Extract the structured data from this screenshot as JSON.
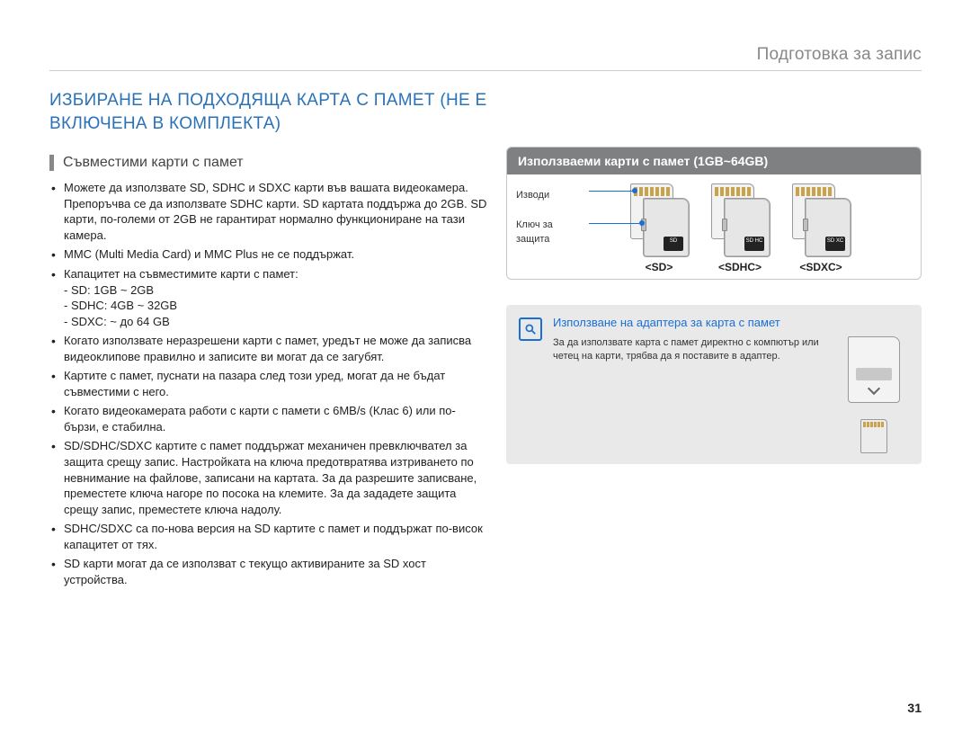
{
  "header": {
    "section": "Подготовка за запис"
  },
  "title": "ИЗБИРАНЕ НА ПОДХОДЯЩА КАРТА С ПАМЕТ (НЕ Е ВКЛЮЧЕНА В КОМПЛЕКТА)",
  "subheading": "Съвместими карти с памет",
  "bullets": [
    "Можете да използвате SD, SDHC и SDXC карти във вашата видеокамера. Препоръчва се да използвате SDHC карти. SD картата поддържа до 2GB. SD карти, по-големи от 2GB не гарантират нормално функциониране на тази камера.",
    "MMC (Multi Media Card) и MMC Plus не се поддържат.",
    "Капацитет на съвместимите карти с памет:",
    "Когато използвате неразрешени карти с памет, уредът не може да записва видеоклипове правилно и записите ви могат да се загубят.",
    "Картите с памет, пуснати на пазара след този уред, могат да не бъдат съвместими с него.",
    "Когато видеокамерата работи с карти с памети с 6MB/s (Клас 6) или по-бързи, е стабилна.",
    "SD/SDHC/SDXC картите с памет поддържат механичен превключвател за защита срещу запис. Настройката на ключа предотвратява изтриването по невнимание на файлове, записани на картата. За да разрешите записване, преместете ключа нагоре по посока на клемите. За да зададете защита срещу запис, преместете ключа надолу.",
    "SDHC/SDXC са по-нова версия на SD картите с памет и поддържат по-висок капацитет от тях.",
    "SD карти могат да се използват с текущо активираните за SD хост устройства."
  ],
  "capacity_sub": [
    "SD: 1GB ~ 2GB",
    "SDHC: 4GB ~ 32GB",
    "SDXC: ~ до 64 GB"
  ],
  "panel": {
    "title": "Използваеми карти с памет (1GB~64GB)",
    "label_terminals": "Изводи",
    "label_lock": "Ключ за защита",
    "cards": [
      {
        "label": "<SD>",
        "logo": "SD"
      },
      {
        "label": "<SDHC>",
        "logo": "SD\nHC"
      },
      {
        "label": "<SDXC>",
        "logo": "SD\nXC"
      }
    ]
  },
  "tip": {
    "title": "Използване на адаптера за карта с памет",
    "text": "За да използвате карта с памет директно с компютър или четец на карти, трябва да я поставите в адаптер."
  },
  "page_number": "31"
}
